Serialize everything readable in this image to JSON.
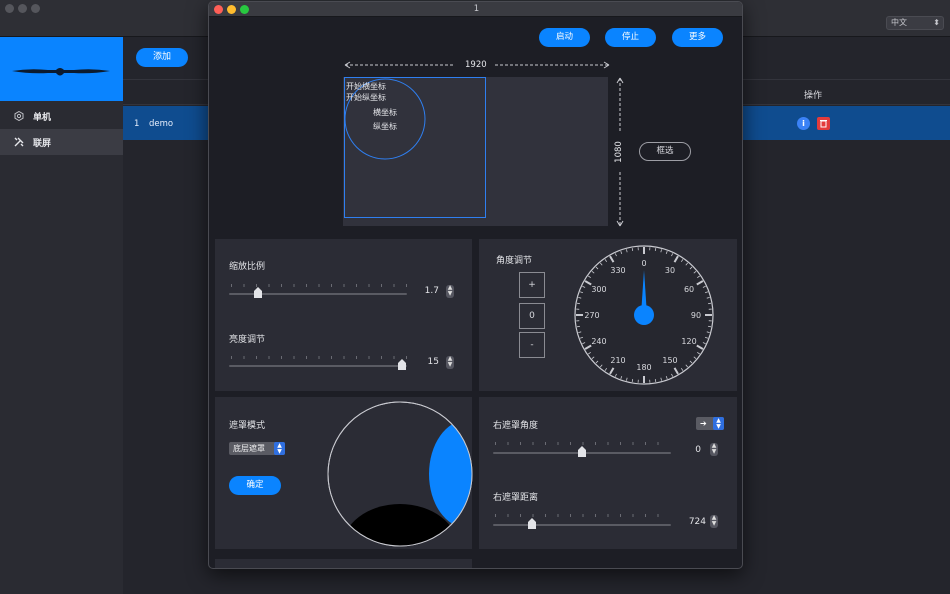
{
  "app": {
    "language": "中文",
    "add_label": "添加",
    "sidebar": {
      "items": [
        {
          "label": "单机"
        },
        {
          "label": "联屏"
        }
      ]
    },
    "table": {
      "ops_header": "操作",
      "rows": [
        {
          "index": "1",
          "name": "demo"
        }
      ]
    }
  },
  "dialog": {
    "title": "1",
    "buttons": {
      "start": "启动",
      "stop": "停止",
      "more": "更多"
    },
    "preview": {
      "width_label": "1920",
      "height_label": "1080",
      "start_x_label": "开始横坐标",
      "start_y_label": "开始纵坐标",
      "x_label": "横坐标",
      "y_label": "纵坐标",
      "box_select": "框选"
    },
    "scale": {
      "title": "缩放比例",
      "value": "1.7",
      "fraction": 0.14
    },
    "brightness": {
      "title": "亮度调节",
      "value": "15",
      "fraction": 1.0
    },
    "angle": {
      "title": "角度调节",
      "plus": "+",
      "value": "0",
      "minus": "-",
      "dial_labels": [
        "0",
        "30",
        "60",
        "90",
        "120",
        "150",
        "180",
        "210",
        "240",
        "270",
        "300",
        "330"
      ],
      "needle_deg": 0
    },
    "mask": {
      "title": "遮罩模式",
      "mode": "底层遮罩",
      "confirm": "确定"
    },
    "right_mask_angle": {
      "title": "右遮罩角度",
      "value": "0",
      "fraction": 0.5,
      "direction": "➔"
    },
    "right_mask_distance": {
      "title": "右遮罩距离",
      "value": "724",
      "fraction": 0.2
    },
    "colors": {
      "accent": "#0a84ff",
      "panel": "#2b2c35",
      "danger": "#e33b3b"
    }
  }
}
